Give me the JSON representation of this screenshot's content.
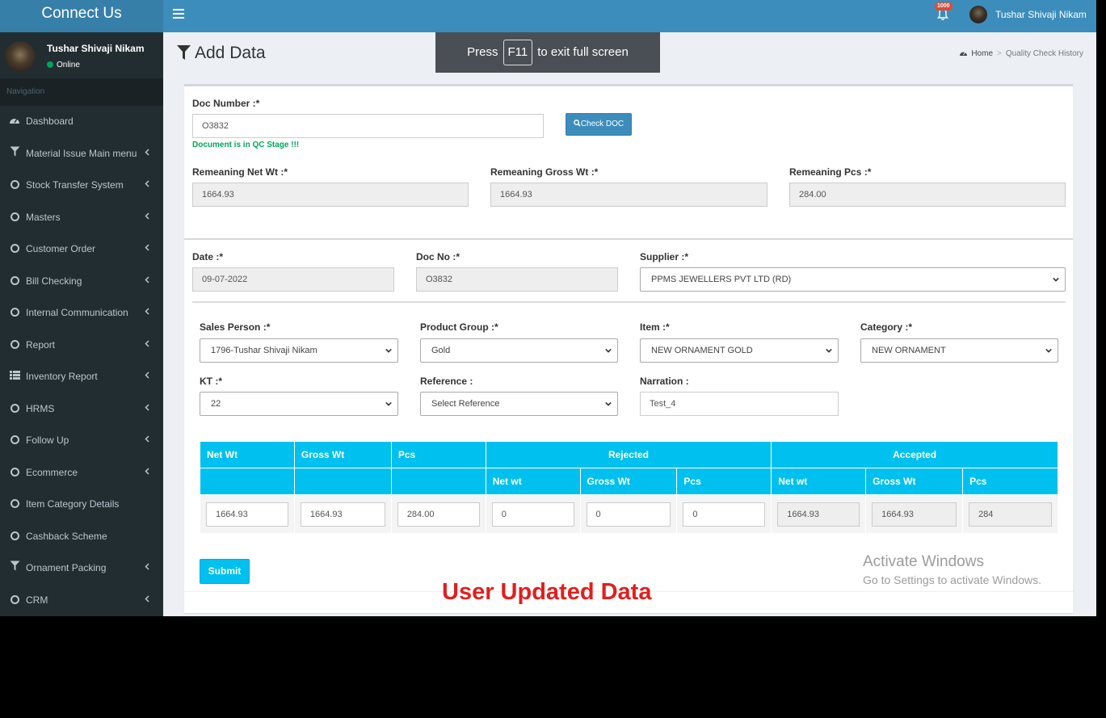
{
  "app": {
    "brand": "Connect Us",
    "notification_count": "1000",
    "user_name": "Tushar Shivaji Nikam"
  },
  "sidebar": {
    "user_name": "Tushar Shivaji Nikam",
    "status": "Online",
    "nav_header": "Navigation",
    "items": [
      {
        "label": "Dashboard",
        "icon": "dashboard-icon",
        "chevron": false
      },
      {
        "label": "Material Issue Main menu",
        "icon": "filter-icon",
        "chevron": true
      },
      {
        "label": "Stock Transfer System",
        "icon": "circle-icon",
        "chevron": true
      },
      {
        "label": "Masters",
        "icon": "circle-icon",
        "chevron": true
      },
      {
        "label": "Customer Order",
        "icon": "circle-icon",
        "chevron": true
      },
      {
        "label": "Bill Checking",
        "icon": "circle-icon",
        "chevron": true
      },
      {
        "label": "Internal Communication",
        "icon": "circle-icon",
        "chevron": true
      },
      {
        "label": "Report",
        "icon": "circle-icon",
        "chevron": true
      },
      {
        "label": "Inventory Report",
        "icon": "list-icon",
        "chevron": true
      },
      {
        "label": "HRMS",
        "icon": "circle-icon",
        "chevron": true
      },
      {
        "label": "Follow Up",
        "icon": "circle-icon",
        "chevron": true
      },
      {
        "label": "Ecommerce",
        "icon": "circle-icon",
        "chevron": true
      },
      {
        "label": "Item Category Details",
        "icon": "circle-icon",
        "chevron": false
      },
      {
        "label": "Cashback Scheme",
        "icon": "circle-icon",
        "chevron": false
      },
      {
        "label": "Ornament Packing",
        "icon": "filter-icon",
        "chevron": true
      },
      {
        "label": "CRM",
        "icon": "circle-icon",
        "chevron": true
      }
    ]
  },
  "page": {
    "title": "Add Data",
    "fullscreen_notice": {
      "before": "Press",
      "key": "F11",
      "after": "to exit full screen"
    },
    "breadcrumb": {
      "home": "Home",
      "current": "Quality Check History"
    }
  },
  "form": {
    "doc_number_label": "Doc Number :*",
    "doc_number_value": "O3832",
    "check_doc_label": "Check DOC",
    "doc_status": "Document is in QC Stage !!!",
    "rem_net_label": "Remeaning Net Wt :*",
    "rem_net_value": "1664.93",
    "rem_gross_label": "Remeaning Gross Wt :*",
    "rem_gross_value": "1664.93",
    "rem_pcs_label": "Remeaning Pcs :*",
    "rem_pcs_value": "284.00",
    "date_label": "Date :*",
    "date_value": "09-07-2022",
    "docno_label": "Doc No :*",
    "docno_value": "O3832",
    "supplier_label": "Supplier :*",
    "supplier_value": "PPMS JEWELLERS PVT LTD (RD)",
    "sales_person_label": "Sales Person :*",
    "sales_person_value": "1796-Tushar Shivaji Nikam",
    "product_group_label": "Product Group :*",
    "product_group_value": "Gold",
    "item_label": "Item :*",
    "item_value": "NEW ORNAMENT GOLD",
    "category_label": "Category :*",
    "category_value": "NEW ORNAMENT",
    "kt_label": "KT :*",
    "kt_value": "22",
    "reference_label": "Reference :",
    "reference_value": "Select Reference",
    "narration_label": "Narration :",
    "narration_value": "Test_4",
    "submit_label": "Submit"
  },
  "table": {
    "headers": {
      "net_wt": "Net Wt",
      "gross_wt": "Gross Wt",
      "pcs": "Pcs",
      "rejected": "Rejected",
      "accepted": "Accepted"
    },
    "sub_headers": {
      "rej_net": "Net wt",
      "rej_gross": "Gross Wt",
      "rej_pcs": "Pcs",
      "acc_net": "Net wt",
      "acc_gross": "Gross Wt",
      "acc_pcs": "Pcs"
    },
    "row": {
      "net_wt": "1664.93",
      "gross_wt": "1664.93",
      "pcs": "284.00",
      "rej_net": "0",
      "rej_gross": "0",
      "rej_pcs": "0",
      "acc_net": "1664.93",
      "acc_gross": "1664.93",
      "acc_pcs": "284"
    }
  },
  "watermark": {
    "line1": "Activate Windows",
    "line2": "Go to Settings to activate Windows."
  },
  "overlay_caption": "User Updated Data"
}
